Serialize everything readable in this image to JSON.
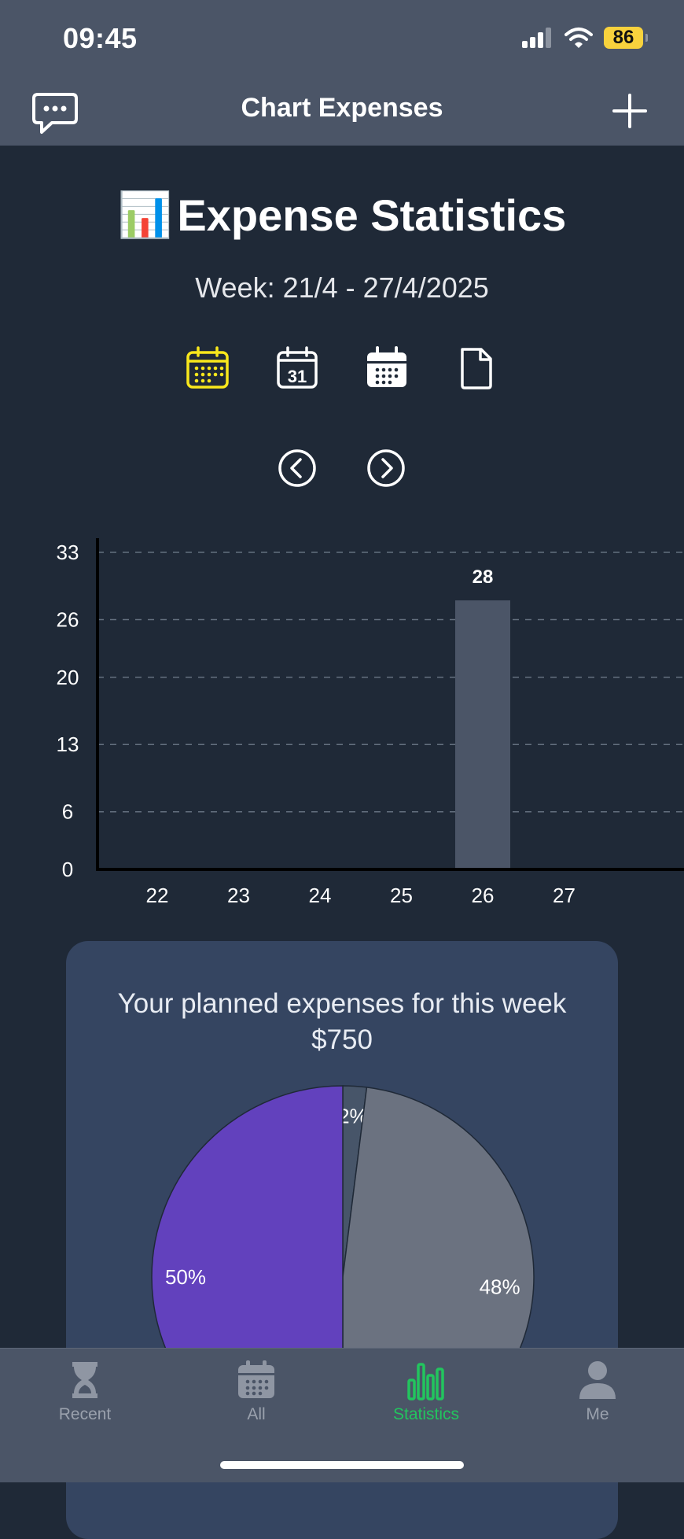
{
  "status_bar": {
    "time": "09:45",
    "battery": "86"
  },
  "header": {
    "title": "Chart Expenses"
  },
  "page": {
    "title_emoji": "📊",
    "title": "Expense Statistics",
    "week_label": "Week: 21/4 - 27/4/2025",
    "period_icons": [
      "week-calendar-icon",
      "month-calendar-icon",
      "year-calendar-icon",
      "document-icon"
    ],
    "nav_icons": [
      "previous-icon",
      "next-icon"
    ]
  },
  "colors": {
    "accent_yellow": "#f8e71c",
    "active_tab": "#22c55e",
    "bar": "#4b5567",
    "pie_purple": "#6241bd",
    "pie_gray": "#6b7280",
    "pie_slate": "#475569"
  },
  "chart_data": [
    {
      "type": "bar",
      "categories": [
        "22",
        "23",
        "24",
        "25",
        "26",
        "27"
      ],
      "values": [
        0,
        0,
        0,
        0,
        28,
        0
      ],
      "data_labels": [
        "",
        "",
        "",
        "",
        "28",
        ""
      ],
      "yticks": [
        "0",
        "6",
        "13",
        "20",
        "26",
        "33"
      ],
      "ylim": [
        0,
        33
      ],
      "grid": true,
      "legend": "none"
    },
    {
      "type": "pie",
      "labels": [
        "2%",
        "48%",
        "50%"
      ],
      "values": [
        2,
        48,
        50
      ],
      "colors": [
        "#475569",
        "#6b7280",
        "#6241bd"
      ]
    }
  ],
  "planned": {
    "line1": "Your planned expenses for this week",
    "line2": "$750"
  },
  "tabs": [
    {
      "label": "Recent",
      "icon": "hourglass-icon",
      "active": false
    },
    {
      "label": "All",
      "icon": "calendar-icon",
      "active": false
    },
    {
      "label": "Statistics",
      "icon": "bar-chart-icon",
      "active": true
    },
    {
      "label": "Me",
      "icon": "person-icon",
      "active": false
    }
  ]
}
